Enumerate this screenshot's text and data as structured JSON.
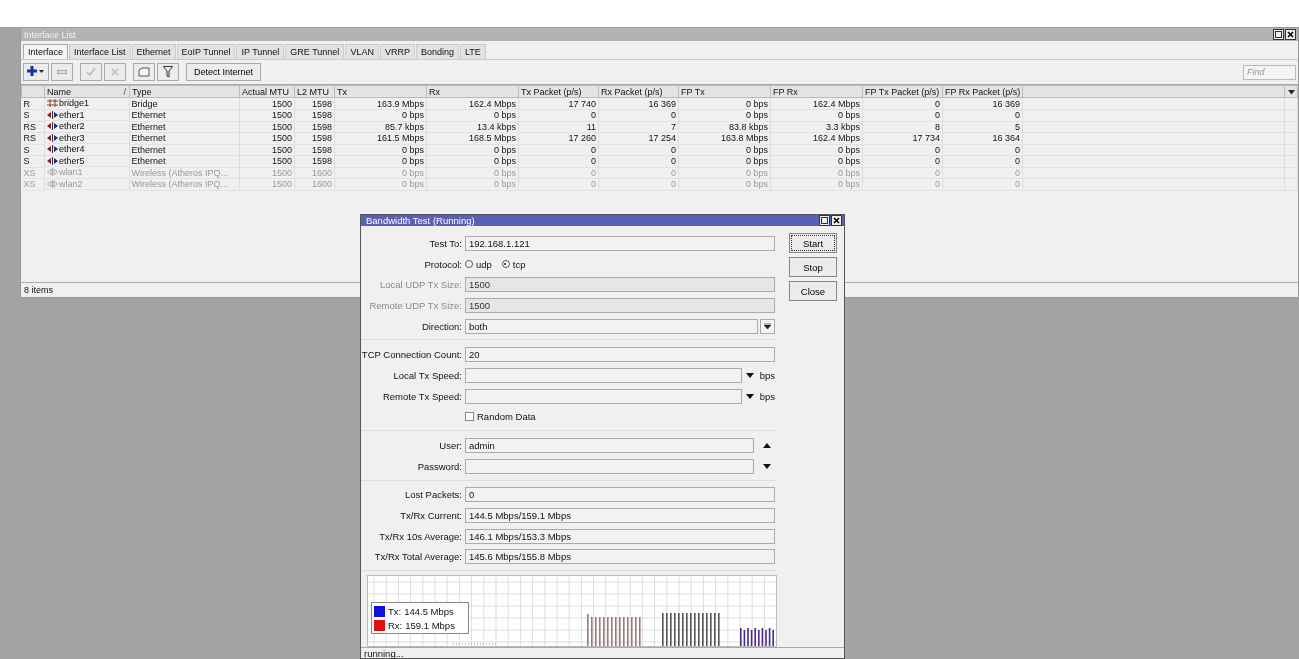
{
  "window": {
    "title": "Interface List"
  },
  "tabs": [
    {
      "label": "Interface",
      "selected": true
    },
    {
      "label": "Interface List",
      "selected": false
    },
    {
      "label": "Ethernet",
      "selected": false
    },
    {
      "label": "EoIP Tunnel",
      "selected": false
    },
    {
      "label": "IP Tunnel",
      "selected": false
    },
    {
      "label": "GRE Tunnel",
      "selected": false
    },
    {
      "label": "VLAN",
      "selected": false
    },
    {
      "label": "VRRP",
      "selected": false
    },
    {
      "label": "Bonding",
      "selected": false
    },
    {
      "label": "LTE",
      "selected": false
    }
  ],
  "toolbar": {
    "detect_button": "Detect Internet",
    "find_placeholder": "Find"
  },
  "table": {
    "columns": [
      {
        "label": "Name",
        "sort_mark": "/"
      },
      {
        "label": "Type"
      },
      {
        "label": "Actual MTU"
      },
      {
        "label": "L2 MTU"
      },
      {
        "label": "Tx"
      },
      {
        "label": "Rx"
      },
      {
        "label": "Tx Packet (p/s)"
      },
      {
        "label": "Rx Packet (p/s)"
      },
      {
        "label": "FP Tx"
      },
      {
        "label": "FP Rx"
      },
      {
        "label": "FP Tx Packet (p/s)"
      },
      {
        "label": "FP Rx Packet (p/s)"
      }
    ],
    "rows": [
      {
        "flags": "R",
        "kind": "bridge",
        "name": "bridge1",
        "type": "Bridge",
        "disabled": false,
        "values": [
          "1500",
          "1598",
          "163.9 Mbps",
          "162.4 Mbps",
          "17 740",
          "16 369",
          "0 bps",
          "162.4 Mbps",
          "0",
          "16 369"
        ]
      },
      {
        "flags": "S",
        "kind": "ethernet",
        "name": "ether1",
        "type": "Ethernet",
        "disabled": false,
        "values": [
          "1500",
          "1598",
          "0 bps",
          "0 bps",
          "0",
          "0",
          "0 bps",
          "0 bps",
          "0",
          "0"
        ]
      },
      {
        "flags": "RS",
        "kind": "ethernet",
        "name": "ether2",
        "type": "Ethernet",
        "disabled": false,
        "values": [
          "1500",
          "1598",
          "85.7 kbps",
          "13.4 kbps",
          "11",
          "7",
          "83.8 kbps",
          "3.3 kbps",
          "8",
          "5"
        ]
      },
      {
        "flags": "RS",
        "kind": "ethernet",
        "name": "ether3",
        "type": "Ethernet",
        "disabled": false,
        "values": [
          "1500",
          "1598",
          "161.5 Mbps",
          "168.5 Mbps",
          "17 260",
          "17 254",
          "163.8 Mbps",
          "162.4 Mbps",
          "17 734",
          "16 364"
        ]
      },
      {
        "flags": "S",
        "kind": "ethernet",
        "name": "ether4",
        "type": "Ethernet",
        "disabled": false,
        "values": [
          "1500",
          "1598",
          "0 bps",
          "0 bps",
          "0",
          "0",
          "0 bps",
          "0 bps",
          "0",
          "0"
        ]
      },
      {
        "flags": "S",
        "kind": "ethernet",
        "name": "ether5",
        "type": "Ethernet",
        "disabled": false,
        "values": [
          "1500",
          "1598",
          "0 bps",
          "0 bps",
          "0",
          "0",
          "0 bps",
          "0 bps",
          "0",
          "0"
        ]
      },
      {
        "flags": "XS",
        "kind": "wireless",
        "name": "wlan1",
        "type": "Wireless (Atheros IPQ...",
        "disabled": true,
        "values": [
          "1500",
          "1600",
          "0 bps",
          "0 bps",
          "0",
          "0",
          "0 bps",
          "0 bps",
          "0",
          "0"
        ]
      },
      {
        "flags": "XS",
        "kind": "wireless",
        "name": "wlan2",
        "type": "Wireless (Atheros IPQ...",
        "disabled": true,
        "values": [
          "1500",
          "1600",
          "0 bps",
          "0 bps",
          "0",
          "0",
          "0 bps",
          "0 bps",
          "0",
          "0"
        ]
      }
    ]
  },
  "status_bar": "8 items",
  "dialog": {
    "title": "Bandwidth Test (Running)",
    "buttons": [
      "Start",
      "Stop",
      "Close"
    ],
    "sections": [
      {
        "fields": [
          {
            "kind": "text",
            "label": "Test To:",
            "value": "192.168.1.121",
            "disabled": false
          },
          {
            "kind": "radio",
            "label": "Protocol:",
            "disabled": false,
            "options": [
              {
                "label": "udp",
                "selected": false
              },
              {
                "label": "tcp",
                "selected": true
              }
            ]
          },
          {
            "kind": "text",
            "label": "Local UDP Tx Size:",
            "value": "1500",
            "disabled": true
          },
          {
            "kind": "text",
            "label": "Remote UDP Tx Size:",
            "value": "1500",
            "disabled": true
          },
          {
            "kind": "select",
            "label": "Direction:",
            "value": "both",
            "disabled": false
          }
        ]
      },
      {
        "fields": [
          {
            "kind": "text",
            "label": "TCP Connection Count:",
            "value": "20",
            "disabled": false
          },
          {
            "kind": "text",
            "label": "Local Tx Speed:",
            "unit": "bps",
            "expanded": false,
            "disabled": false
          },
          {
            "kind": "text",
            "label": "Remote Tx Speed:",
            "unit": "bps",
            "expanded": false,
            "disabled": false
          },
          {
            "kind": "checkbox",
            "label": "Random Data",
            "checked": false
          }
        ]
      },
      {
        "fields": [
          {
            "kind": "text",
            "label": "User:",
            "value": "admin",
            "expanded": true,
            "disabled": false
          },
          {
            "kind": "text",
            "label": "Password:",
            "expanded": false,
            "disabled": false
          }
        ]
      },
      {
        "fields": [
          {
            "kind": "text",
            "label": "Lost Packets:",
            "value": "0",
            "disabled": false
          },
          {
            "kind": "text",
            "label": "Tx/Rx Current:",
            "value": "144.5 Mbps/159.1 Mbps",
            "disabled": false
          },
          {
            "kind": "text",
            "label": "Tx/Rx 10s Average:",
            "value": "146.1 Mbps/153.3 Mbps",
            "disabled": false
          },
          {
            "kind": "text",
            "label": "Tx/Rx Total Average:",
            "value": "145.6 Mbps/155.8 Mbps",
            "disabled": false
          }
        ]
      }
    ],
    "graph": {
      "legend": [
        {
          "label": "Tx:",
          "value": "144.5 Mbps",
          "color": "#1010e0"
        },
        {
          "label": "Rx:",
          "value": "159.1 Mbps",
          "color": "#e01010"
        }
      ]
    },
    "status": "running..."
  }
}
